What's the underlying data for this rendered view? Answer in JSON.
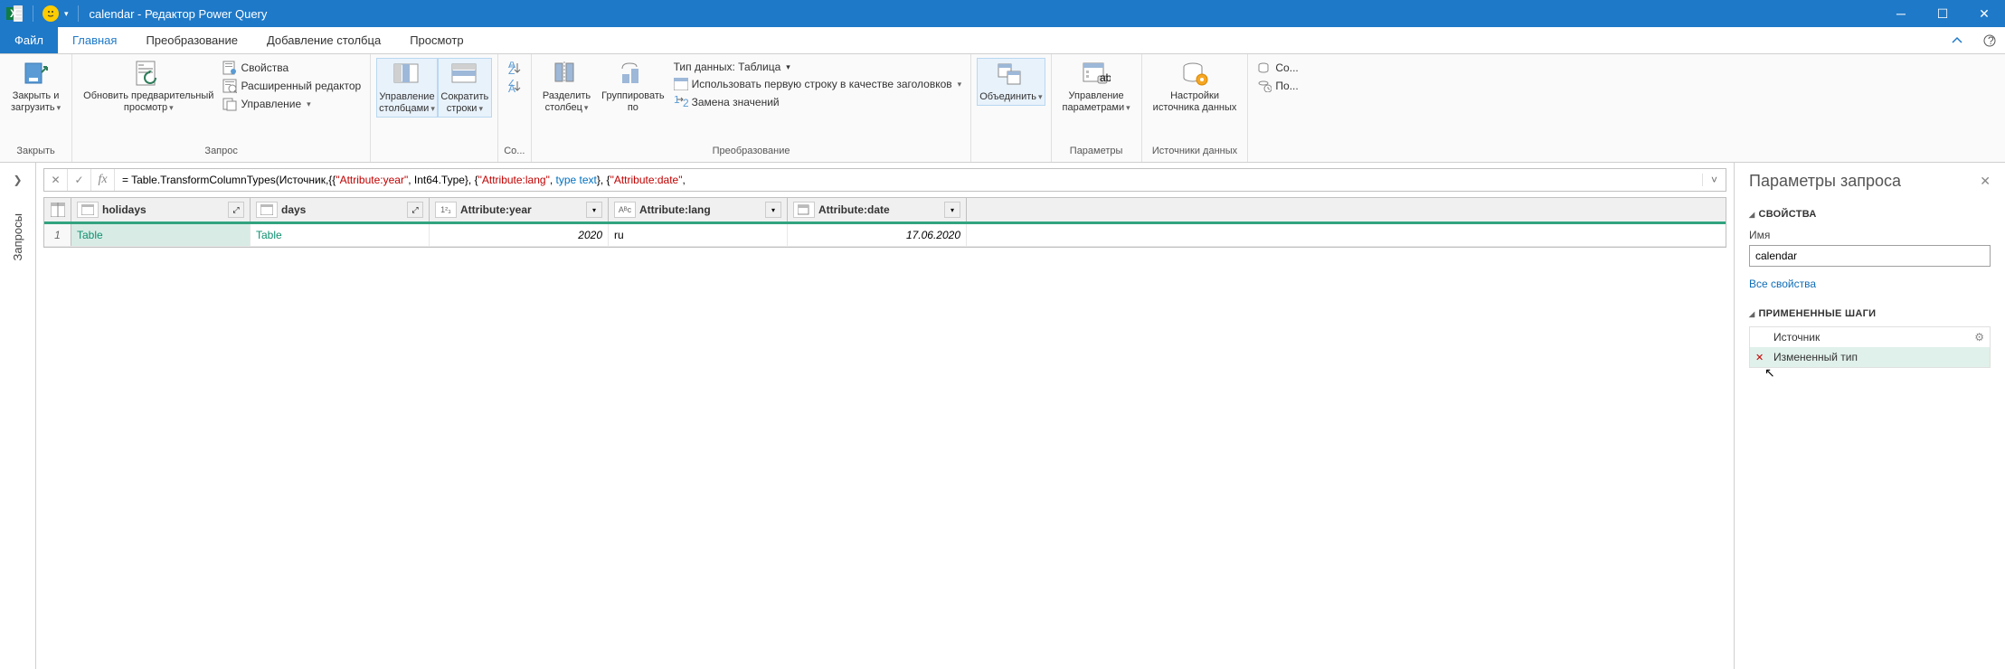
{
  "titlebar": {
    "title": "calendar - Редактор Power Query"
  },
  "tabs": {
    "file": "Файл",
    "home": "Главная",
    "transform": "Преобразование",
    "addcol": "Добавление столбца",
    "view": "Просмотр"
  },
  "ribbon": {
    "close_group": "Закрыть",
    "close_load": "Закрыть и\nзагрузить",
    "refresh_preview": "Обновить предварительный\nпросмотр",
    "properties": "Свойства",
    "advanced_editor": "Расширенный редактор",
    "manage": "Управление",
    "query_group": "Запрос",
    "manage_columns": "Управление\nстолбцами",
    "reduce_rows": "Сократить\nстроки",
    "sort_group": "Со...",
    "split_column": "Разделить\nстолбец",
    "group_by": "Группировать\nпо",
    "data_type_label": "Тип данных: Таблица",
    "first_row_headers": "Использовать первую строку в качестве заголовков",
    "replace_values": "Замена значений",
    "transformation_group": "Преобразование",
    "merge_queries": "Объединить",
    "manage_params": "Управление\nпараметрами",
    "params_group": "Параметры",
    "data_source_settings": "Настройки\nисточника данных",
    "sources_group": "Источники данных",
    "new_source": "Со...",
    "recent": "По..."
  },
  "queries_label": "Запросы",
  "formula": {
    "prefix": "= Table.TransformColumnTypes(Источник,{{",
    "s1": "\"Attribute:year\"",
    "p2": ", Int64.Type}, {",
    "s2": "\"Attribute:lang\"",
    "p3": ", ",
    "kw": "type text",
    "p4": "}, {",
    "s3": "\"Attribute:date\"",
    "p5": ","
  },
  "grid": {
    "columns": [
      {
        "name": "holidays",
        "type": "table",
        "expandable": true
      },
      {
        "name": "days",
        "type": "table",
        "expandable": true
      },
      {
        "name": "Attribute:year",
        "type": "123",
        "expandable": false
      },
      {
        "name": "Attribute:lang",
        "type": "ABC",
        "expandable": false
      },
      {
        "name": "Attribute:date",
        "type": "cal",
        "expandable": false
      }
    ],
    "rows": [
      {
        "num": "1",
        "cells": [
          "Table",
          "Table",
          "2020",
          "ru",
          "17.06.2020"
        ]
      }
    ]
  },
  "rightpane": {
    "title": "Параметры запроса",
    "properties_section": "СВОЙСТВА",
    "name_label": "Имя",
    "name_value": "calendar",
    "all_properties": "Все свойства",
    "applied_steps": "ПРИМЕНЕННЫЕ ШАГИ",
    "steps": [
      {
        "label": "Источник",
        "gear": true
      },
      {
        "label": "Измененный тип",
        "selected": true
      }
    ]
  }
}
